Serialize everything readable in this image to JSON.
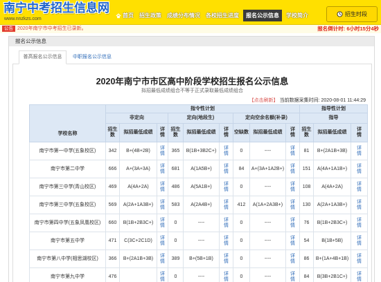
{
  "header": {
    "site_title": "南宁中考招生信息网",
    "site_url": "www.nnzkzs.com",
    "period_button": "招生时段",
    "period_icon": "clock-icon"
  },
  "nav": {
    "items": [
      {
        "label": "首页",
        "icon": "home-icon",
        "active": false
      },
      {
        "label": "招生政策",
        "active": false
      },
      {
        "label": "成绩分布情况",
        "active": false
      },
      {
        "label": "各校招生进度",
        "active": false
      },
      {
        "label": "报名公示信息",
        "active": true
      },
      {
        "label": "学校简介",
        "active": false
      }
    ]
  },
  "notice": {
    "badge": "公告",
    "text": "2020年南宁市中考招生已录新。",
    "countdown": "报名倒计时: 6小时15分4秒"
  },
  "section": {
    "title": "报名公示信息",
    "tabs": [
      {
        "label": "普高报名公示信息",
        "active": true
      },
      {
        "label": "中职报名公示信息",
        "active": false
      }
    ]
  },
  "content": {
    "title": "2020年南宁市市区高中阶段学校招生报名公示信息",
    "subtitle": "拟招最低成绩组合不等于正式录取最低成绩组合",
    "refresh_link": "【点击刷新】",
    "data_time": "当前数据采集时间: 2020-08-01 11:44:29"
  },
  "table": {
    "headers": {
      "school": "学校名称",
      "mandatory_plan": "指令性计划",
      "guidance_plan": "指导性计划",
      "non_directed": "非定向",
      "directed": "定向(地段生)",
      "directed_vacancy": "定向空余名额(补录)",
      "guidance": "指导",
      "enroll_count": "招生数",
      "min_score": "拟招最低成绩",
      "detail": "详情",
      "vacancy_count": "空缺数"
    },
    "detail_label": "详情",
    "rows": [
      {
        "school": "南宁市第一中学(五象校区)",
        "non_directed": {
          "count": "342",
          "min_score": "B+(4B+2B)"
        },
        "directed": {
          "count": "365",
          "min_score": "B(1B+3B2C+)"
        },
        "vacancy": {
          "count": "0",
          "min_score": "----"
        },
        "guidance": {
          "count": "81",
          "min_score": "B+(2A1B+3B)"
        }
      },
      {
        "school": "南宁市第二中学",
        "non_directed": {
          "count": "666",
          "min_score": "A+(3A+3A)"
        },
        "directed": {
          "count": "681",
          "min_score": "A(1A5B+)"
        },
        "vacancy": {
          "count": "84",
          "min_score": "A+(3A+1A2B+)"
        },
        "guidance": {
          "count": "151",
          "min_score": "A(4A+1A1B+)"
        }
      },
      {
        "school": "南宁市第三中学(青山校区)",
        "non_directed": {
          "count": "469",
          "min_score": "A(4A+2A)"
        },
        "directed": {
          "count": "486",
          "min_score": "A(5A1B+)"
        },
        "vacancy": {
          "count": "0",
          "min_score": "----"
        },
        "guidance": {
          "count": "108",
          "min_score": "A(4A+2A)"
        }
      },
      {
        "school": "南宁市第三中学(五象校区)",
        "non_directed": {
          "count": "569",
          "min_score": "A(2A+1A3B+)"
        },
        "directed": {
          "count": "583",
          "min_score": "A(2A4B+)"
        },
        "vacancy": {
          "count": "412",
          "min_score": "A(1A+2A3B+)"
        },
        "guidance": {
          "count": "130",
          "min_score": "A(2A+1A3B+)"
        }
      },
      {
        "school": "南宁市第四中学(五象凤凰校区)",
        "non_directed": {
          "count": "660",
          "min_score": "B(1B+2B3C+)"
        },
        "directed": {
          "count": "0",
          "min_score": "----"
        },
        "vacancy": {
          "count": "0",
          "min_score": "----"
        },
        "guidance": {
          "count": "76",
          "min_score": "B(1B+2B3C+)"
        }
      },
      {
        "school": "南宁市第五中学",
        "non_directed": {
          "count": "471",
          "min_score": "C(3C+2C1D)"
        },
        "directed": {
          "count": "0",
          "min_score": "----"
        },
        "vacancy": {
          "count": "0",
          "min_score": "----"
        },
        "guidance": {
          "count": "54",
          "min_score": "B(1B+5B)"
        }
      },
      {
        "school": "南宁市第八中学(相思湖校区)",
        "non_directed": {
          "count": "366",
          "min_score": "B+(2A1B+3B)"
        },
        "directed": {
          "count": "389",
          "min_score": "B+(5B+1B)"
        },
        "vacancy": {
          "count": "0",
          "min_score": "----"
        },
        "guidance": {
          "count": "86",
          "min_score": "B+(1A+4B+1B)"
        }
      },
      {
        "school": "南宁市第九中学",
        "non_directed": {
          "count": "476",
          "min_score": ""
        },
        "directed": {
          "count": "0",
          "min_score": "----"
        },
        "vacancy": {
          "count": "0",
          "min_score": "----"
        },
        "guidance": {
          "count": "84",
          "min_score": "B(3B+2B1C+)"
        }
      }
    ]
  },
  "colors": {
    "header_bg": "#FFE000",
    "logo_blue": "#2266CC",
    "alert_red": "#E0261B",
    "link_blue": "#2E6BB8",
    "table_header_bg": "#DDE8F5",
    "active_nav_bg": "#3B3B3B"
  }
}
